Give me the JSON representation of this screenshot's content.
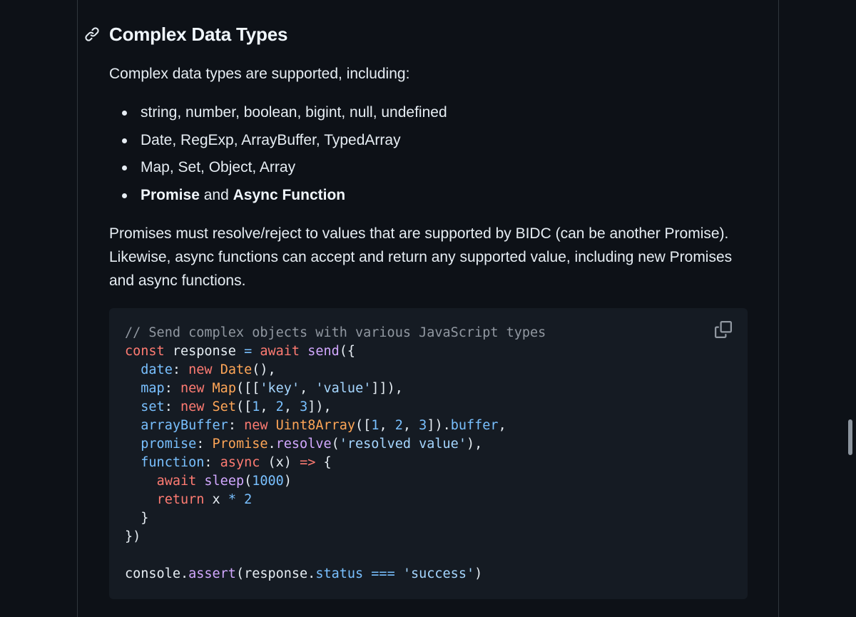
{
  "section": {
    "heading": "Complex Data Types",
    "intro": "Complex data types are supported, including:",
    "list": [
      "string, number, boolean, bigint, null, undefined",
      "Date, RegExp, ArrayBuffer, TypedArray",
      "Map, Set, Object, Array"
    ],
    "list_last": {
      "strong1": "Promise",
      "mid": " and ",
      "strong2": "Async Function"
    },
    "paragraph": "Promises must resolve/reject to values that are supported by BIDC (can be another Promise). Likewise, async functions can accept and return any supported value, including new Promises and async functions."
  },
  "code": {
    "lines": [
      [
        [
          "c-com",
          "// Send complex objects with various JavaScript types"
        ]
      ],
      [
        [
          "c-kw",
          "const"
        ],
        [
          "",
          " response "
        ],
        [
          "c-op",
          "="
        ],
        [
          "",
          " "
        ],
        [
          "c-kw",
          "await"
        ],
        [
          "",
          " "
        ],
        [
          "c-fn",
          "send"
        ],
        [
          "",
          "({"
        ]
      ],
      [
        [
          "",
          "  "
        ],
        [
          "c-prop",
          "date"
        ],
        [
          "",
          ": "
        ],
        [
          "c-kw",
          "new"
        ],
        [
          "",
          " "
        ],
        [
          "c-cls",
          "Date"
        ],
        [
          "",
          "(),"
        ]
      ],
      [
        [
          "",
          "  "
        ],
        [
          "c-prop",
          "map"
        ],
        [
          "",
          ": "
        ],
        [
          "c-kw",
          "new"
        ],
        [
          "",
          " "
        ],
        [
          "c-cls",
          "Map"
        ],
        [
          "",
          "([["
        ],
        [
          "c-str",
          "'key'"
        ],
        [
          "",
          ", "
        ],
        [
          "c-str",
          "'value'"
        ],
        [
          "",
          "]]),"
        ]
      ],
      [
        [
          "",
          "  "
        ],
        [
          "c-prop",
          "set"
        ],
        [
          "",
          ": "
        ],
        [
          "c-kw",
          "new"
        ],
        [
          "",
          " "
        ],
        [
          "c-cls",
          "Set"
        ],
        [
          "",
          "(["
        ],
        [
          "c-num",
          "1"
        ],
        [
          "",
          ", "
        ],
        [
          "c-num",
          "2"
        ],
        [
          "",
          ", "
        ],
        [
          "c-num",
          "3"
        ],
        [
          "",
          "]),"
        ]
      ],
      [
        [
          "",
          "  "
        ],
        [
          "c-prop",
          "arrayBuffer"
        ],
        [
          "",
          ": "
        ],
        [
          "c-kw",
          "new"
        ],
        [
          "",
          " "
        ],
        [
          "c-cls",
          "Uint8Array"
        ],
        [
          "",
          "(["
        ],
        [
          "c-num",
          "1"
        ],
        [
          "",
          ", "
        ],
        [
          "c-num",
          "2"
        ],
        [
          "",
          ", "
        ],
        [
          "c-num",
          "3"
        ],
        [
          "",
          "])."
        ],
        [
          "c-prop",
          "buffer"
        ],
        [
          "",
          ","
        ]
      ],
      [
        [
          "",
          "  "
        ],
        [
          "c-prop",
          "promise"
        ],
        [
          "",
          ": "
        ],
        [
          "c-cls",
          "Promise"
        ],
        [
          "",
          "."
        ],
        [
          "c-fn",
          "resolve"
        ],
        [
          "",
          "("
        ],
        [
          "c-str",
          "'resolved value'"
        ],
        [
          "",
          "),"
        ]
      ],
      [
        [
          "",
          "  "
        ],
        [
          "c-prop",
          "function"
        ],
        [
          "",
          ": "
        ],
        [
          "c-kw",
          "async"
        ],
        [
          "",
          " (x) "
        ],
        [
          "c-kw",
          "=>"
        ],
        [
          "",
          " {"
        ]
      ],
      [
        [
          "",
          "    "
        ],
        [
          "c-kw",
          "await"
        ],
        [
          "",
          " "
        ],
        [
          "c-fn",
          "sleep"
        ],
        [
          "",
          "("
        ],
        [
          "c-num",
          "1000"
        ],
        [
          "",
          ")"
        ]
      ],
      [
        [
          "",
          "    "
        ],
        [
          "c-kw",
          "return"
        ],
        [
          "",
          " x "
        ],
        [
          "c-op",
          "*"
        ],
        [
          "",
          " "
        ],
        [
          "c-num",
          "2"
        ]
      ],
      [
        [
          "",
          "  }"
        ]
      ],
      [
        [
          "",
          "})"
        ]
      ],
      [
        [
          "",
          ""
        ]
      ],
      [
        [
          "",
          "console."
        ],
        [
          "c-fn",
          "assert"
        ],
        [
          "",
          "(response."
        ],
        [
          "c-prop",
          "status"
        ],
        [
          "",
          " "
        ],
        [
          "c-op",
          "==="
        ],
        [
          "",
          " "
        ],
        [
          "c-str",
          "'success'"
        ],
        [
          "",
          ")"
        ]
      ]
    ]
  },
  "icons": {
    "anchor": "link-icon",
    "copy": "copy-icon"
  },
  "colors": {
    "background": "#0d1117",
    "code_background": "#151b23",
    "keyword": "#ff7b72",
    "function": "#d2a8ff",
    "class": "#ffa657",
    "property": "#79c0ff",
    "string": "#a5d6ff",
    "comment": "#9198a1"
  }
}
